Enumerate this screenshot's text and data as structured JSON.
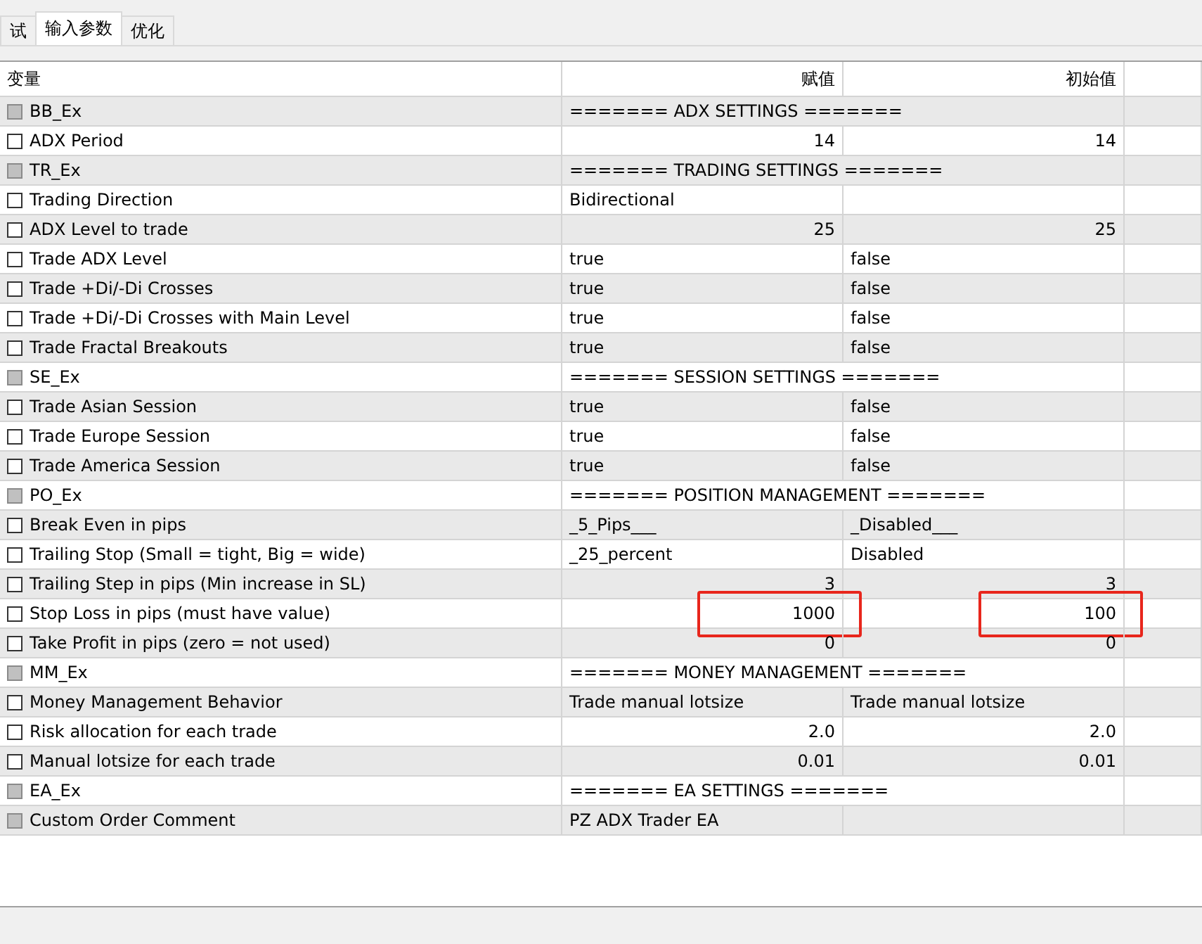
{
  "tabs": [
    {
      "label": "试",
      "selected": false
    },
    {
      "label": "输入参数",
      "selected": true
    },
    {
      "label": "优化",
      "selected": false
    }
  ],
  "columns": [
    "变量",
    "赋值",
    "初始值"
  ],
  "rows": [
    {
      "kind": "group",
      "name": "BB_Ex",
      "checked": false,
      "value": "======= ADX SETTINGS ======="
    },
    {
      "kind": "number",
      "name": "ADX Period",
      "checked": false,
      "value": "14",
      "initial": "14"
    },
    {
      "kind": "group",
      "name": "TR_Ex",
      "checked": false,
      "value": "======= TRADING SETTINGS ======="
    },
    {
      "kind": "text",
      "name": "Trading Direction",
      "checked": false,
      "value": "Bidirectional"
    },
    {
      "kind": "number",
      "name": "ADX Level to trade",
      "checked": false,
      "value": "25",
      "initial": "25"
    },
    {
      "kind": "text",
      "name": "Trade ADX Level",
      "checked": false,
      "value": "true",
      "initial": "false"
    },
    {
      "kind": "text",
      "name": "Trade +Di/-Di Crosses",
      "checked": false,
      "value": "true",
      "initial": "false"
    },
    {
      "kind": "text",
      "name": "Trade +Di/-Di Crosses with Main Level",
      "checked": false,
      "value": "true",
      "initial": "false"
    },
    {
      "kind": "text",
      "name": "Trade Fractal Breakouts",
      "checked": false,
      "value": "true",
      "initial": "false"
    },
    {
      "kind": "group",
      "name": "SE_Ex",
      "checked": false,
      "value": "======= SESSION SETTINGS ======="
    },
    {
      "kind": "text",
      "name": "Trade Asian Session",
      "checked": false,
      "value": "true",
      "initial": "false"
    },
    {
      "kind": "text",
      "name": "Trade Europe Session",
      "checked": false,
      "value": "true",
      "initial": "false"
    },
    {
      "kind": "text",
      "name": "Trade America Session",
      "checked": false,
      "value": "true",
      "initial": "false"
    },
    {
      "kind": "group",
      "name": "PO_Ex",
      "checked": false,
      "value": "======= POSITION MANAGEMENT ======="
    },
    {
      "kind": "text",
      "name": "Break Even in pips",
      "checked": false,
      "value": "_5_Pips___",
      "initial": "_Disabled___"
    },
    {
      "kind": "text",
      "name": "Trailing Stop (Small = tight, Big = wide)",
      "checked": false,
      "value": "_25_percent",
      "initial": "Disabled"
    },
    {
      "kind": "number",
      "name": "Trailing Step in pips (Min increase in SL)",
      "checked": false,
      "value": "3",
      "initial": "3"
    },
    {
      "kind": "number",
      "name": "Stop Loss in pips (must have value)",
      "checked": false,
      "value": "1000",
      "initial": "100",
      "highlighted": true
    },
    {
      "kind": "number",
      "name": "Take Profit in pips (zero = not used)",
      "checked": false,
      "value": "0",
      "initial": "0"
    },
    {
      "kind": "group",
      "name": "MM_Ex",
      "checked": false,
      "value": "======= MONEY MANAGEMENT ======="
    },
    {
      "kind": "text",
      "name": "Money Management Behavior",
      "checked": false,
      "value": "Trade manual lotsize",
      "initial": "Trade manual lotsize"
    },
    {
      "kind": "number",
      "name": "Risk allocation for each trade",
      "checked": false,
      "value": "2.0",
      "initial": "2.0"
    },
    {
      "kind": "number",
      "name": "Manual lotsize for each trade",
      "checked": false,
      "value": "0.01",
      "initial": "0.01"
    },
    {
      "kind": "group",
      "name": "EA_Ex",
      "checked": false,
      "value": "======= EA SETTINGS ======="
    },
    {
      "kind": "text-group",
      "name": "Custom Order Comment",
      "checked": false,
      "value": "PZ ADX Trader EA"
    }
  ]
}
